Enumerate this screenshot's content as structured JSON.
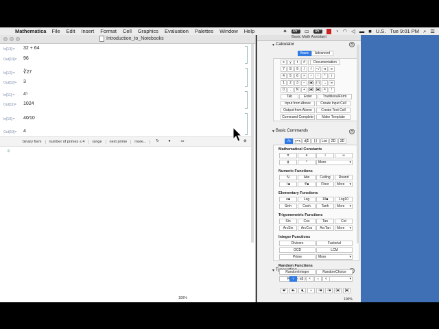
{
  "menubar": {
    "app": "Mathematica",
    "items": [
      "File",
      "Edit",
      "Insert",
      "Format",
      "Cell",
      "Graphics",
      "Evaluation",
      "Palettes",
      "Window",
      "Help"
    ],
    "status": {
      "temp1": "45°",
      "temp2": "45°",
      "input": "U.S.",
      "clock": "Tue 9:01 PM"
    }
  },
  "notebook": {
    "title": "Introduction_to_Notebooks",
    "cells": [
      {
        "label": "In[13]:=",
        "text": "32 + 64"
      },
      {
        "label": "Out[13]=",
        "text": "96"
      },
      {
        "label": "In[12]:=",
        "text": "∛27"
      },
      {
        "label": "Out[12]=",
        "text": "3"
      },
      {
        "label": "In[11]:=",
        "text": "4⁵"
      },
      {
        "label": "Out[11]=",
        "text": "1024"
      },
      {
        "label": "In[10]:=",
        "text": "40⁄10"
      },
      {
        "label": "Out[10]=",
        "text": "4"
      }
    ],
    "suggestions": [
      "binary form",
      "number of primes ≤ 4",
      "range",
      "next prime",
      "more..."
    ],
    "zoom": "100%"
  },
  "palette": {
    "title": "Basic Math Assistant",
    "calculator": {
      "heading": "Calculator",
      "tabs": [
        "Basic",
        "Advanced"
      ],
      "rows": [
        [
          "x",
          "y",
          "t",
          "#",
          "^",
          "Documentation"
        ],
        [
          "7",
          "8",
          "9",
          "/",
          "√",
          "ⁿ√",
          "π",
          "e"
        ],
        [
          "4",
          "5",
          "6",
          "×",
          "ⁿ",
          "ⁿ",
          "°",
          "i"
        ],
        [
          "1",
          "2",
          "3",
          "−",
          "(■)",
          "(·)",
          "→",
          "∞"
        ],
        [
          "0",
          ".",
          "N",
          "+",
          "{■}",
          "[■]",
          "=",
          "!"
        ]
      ],
      "keys": [
        "Tab",
        "Enter",
        "TraditionalForm"
      ],
      "actions": [
        "Input from Above",
        "Create Input Cell",
        "Output from Above",
        "Create Text Cell",
        "Command Complete",
        "Make Template"
      ]
    },
    "basic": {
      "heading": "Basic Commands",
      "tabs": [
        "√x",
        "y=x",
        "d∫Σ",
        "(:)",
        "List",
        "2D",
        "3D"
      ],
      "groups": [
        {
          "title": "Mathematical Constants",
          "items": [
            "π",
            "e",
            "i",
            "∞",
            "ϕ",
            "°"
          ],
          "more": "More"
        },
        {
          "title": "Numeric Functions",
          "items": [
            "N",
            "Abs",
            "Ceiling",
            "Round",
            "√■",
            "∜■",
            "Floor"
          ],
          "more": "More"
        },
        {
          "title": "Elementary Functions",
          "items": [
            "e■",
            "Log",
            "10■",
            "Log10",
            "Sinh",
            "Cosh",
            "Tanh"
          ],
          "more": "More"
        },
        {
          "title": "Trigonometric Functions",
          "items": [
            "Sin",
            "Cos",
            "Tan",
            "Cot",
            "ArcSin",
            "ArcCos",
            "ArcTan"
          ],
          "more": "More"
        },
        {
          "title": "Integer Functions",
          "items": [
            "Divisors",
            "Factorial",
            "GCD",
            "LCM",
            "Prime"
          ],
          "more": "More"
        },
        {
          "title": "Random Functions",
          "items": [
            "RandomInteger",
            "RandomChoice",
            "RandomReal"
          ],
          "more": "More"
        }
      ]
    },
    "typesetting": {
      "heading": "Typesetting",
      "zoom": "100%"
    }
  }
}
